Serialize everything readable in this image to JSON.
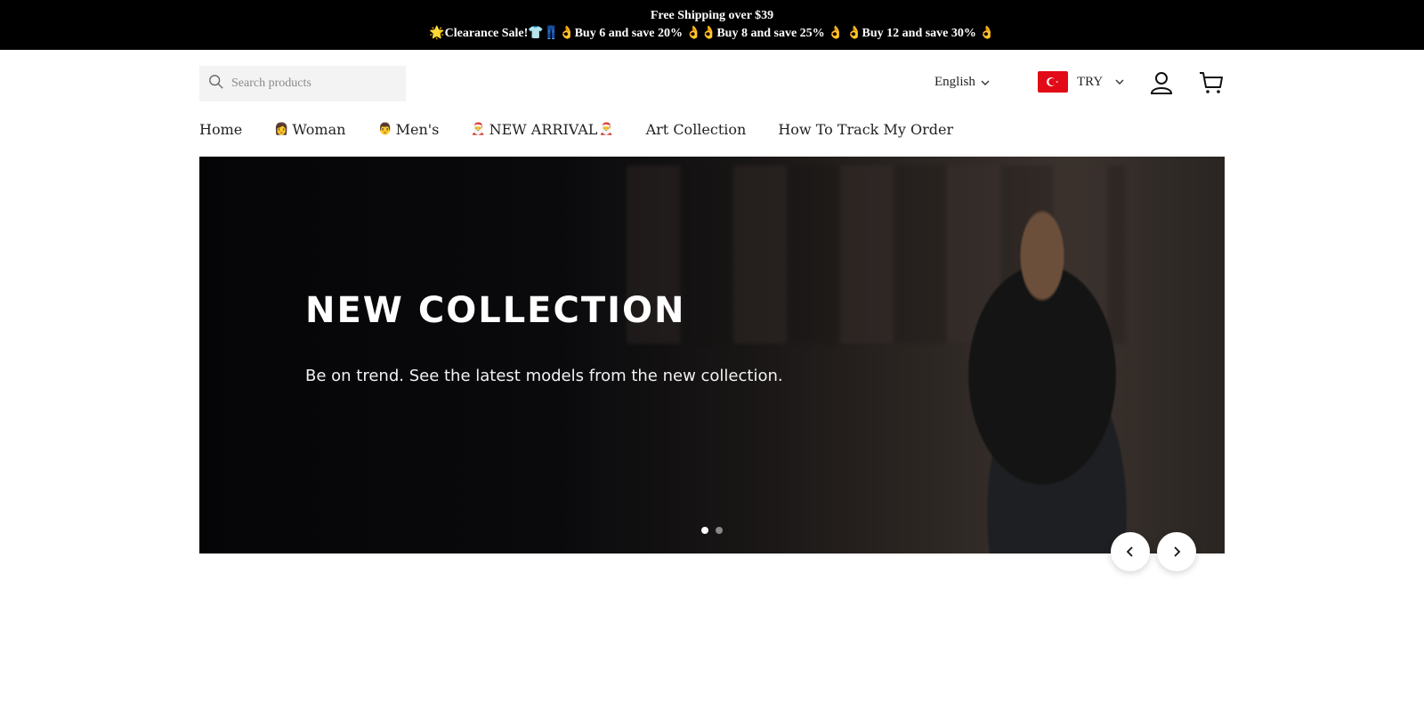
{
  "announcement": {
    "line1": "Free Shipping over $39",
    "line2": "🌟Clearance Sale!👕👖👌Buy 6 and save 20% 👌👌Buy 8 and save 25% 👌 👌Buy 12 and save 30% 👌"
  },
  "search": {
    "placeholder": "Search products"
  },
  "language": {
    "label": "English"
  },
  "currency": {
    "code": "TRY",
    "flag_color": "#e30a17"
  },
  "nav": [
    {
      "label": "Home"
    },
    {
      "label": "Woman",
      "icon": "👩"
    },
    {
      "label": "Men's",
      "icon": "👨"
    },
    {
      "label": "NEW ARRIVAL",
      "icon_left": "🎅",
      "icon_right": "🎅"
    },
    {
      "label": "Art Collection"
    },
    {
      "label": "How To Track My Order"
    }
  ],
  "hero": {
    "title": "NEW COLLECTION",
    "subtitle": "Be on trend. See the latest models from the new collection.",
    "slides": 2,
    "active_slide": 1
  }
}
